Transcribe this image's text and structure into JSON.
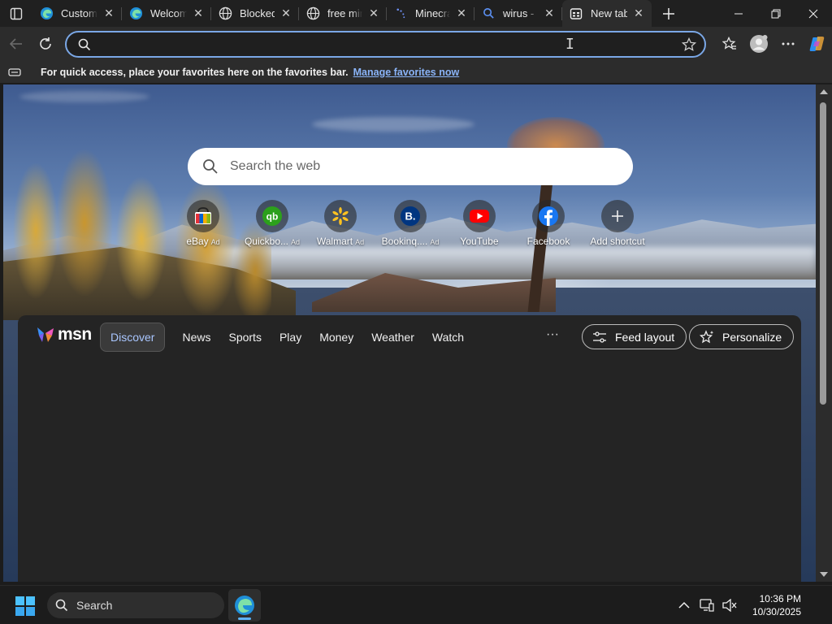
{
  "tabs": [
    {
      "title": "Customiz",
      "icon": "edge-icon",
      "active": false
    },
    {
      "title": "Welcome",
      "icon": "edge-icon",
      "active": false
    },
    {
      "title": "Blocked",
      "icon": "globe-icon",
      "active": false
    },
    {
      "title": "free mine",
      "icon": "globe-icon",
      "active": false
    },
    {
      "title": "Minecraf",
      "icon": "loading-icon",
      "active": false
    },
    {
      "title": "wirus - S",
      "icon": "search-icon",
      "active": false
    },
    {
      "title": "New tab",
      "icon": "newtab-icon",
      "active": true
    }
  ],
  "address": {
    "value": "",
    "placeholder": ""
  },
  "favorites_bar": {
    "message": "For quick access, place your favorites here on the favorites bar.",
    "link": "Manage favorites now"
  },
  "newtab": {
    "search_placeholder": "Search the web",
    "shortcuts": [
      {
        "label": "eBay",
        "ad": "Ad",
        "icon": "ebay-icon"
      },
      {
        "label": "Quickbo...",
        "ad": "Ad",
        "icon": "quickbooks-icon"
      },
      {
        "label": "Walmart",
        "ad": "Ad",
        "icon": "walmart-icon"
      },
      {
        "label": "Bookinq....",
        "ad": "Ad",
        "icon": "booking-icon"
      },
      {
        "label": "YouTube",
        "ad": "",
        "icon": "youtube-icon"
      },
      {
        "label": "Facebook",
        "ad": "",
        "icon": "facebook-icon"
      },
      {
        "label": "Add shortcut",
        "ad": "",
        "icon": "plus-icon"
      }
    ]
  },
  "feed": {
    "brand": "msn",
    "nav": [
      "Discover",
      "News",
      "Sports",
      "Play",
      "Money",
      "Weather",
      "Watch"
    ],
    "more": "···",
    "feed_layout": "Feed layout",
    "personalize": "Personalize"
  },
  "taskbar": {
    "search_label": "Search",
    "time": "10:36 PM",
    "date": "10/30/2025"
  },
  "colors": {
    "accent_blue": "#7aa7e6",
    "link_blue": "#8ab4f8",
    "discover_text": "#a9c6ff"
  }
}
